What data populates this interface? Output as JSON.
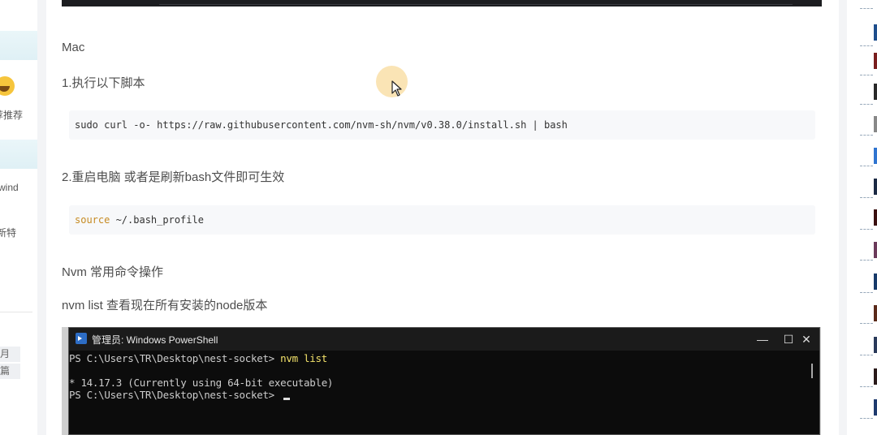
{
  "left_sidebar": {
    "texts": [
      "荐推荐",
      "wind",
      "新特"
    ],
    "chips": [
      "月",
      "篇"
    ]
  },
  "article": {
    "heading_mac": "Mac",
    "step1": "1.执行以下脚本",
    "code1": "sudo curl -o- https://raw.githubusercontent.com/nvm-sh/nvm/v0.38.0/install.sh | bash",
    "step2": "2.重启电脑 或者是刷新bash文件即可生效",
    "code2_keyword": "source",
    "code2_rest": " ~/.bash_profile",
    "heading_nvm": "Nvm 常用命令操作",
    "nvm_list_desc": "nvm list 查看现在所有安装的node版本"
  },
  "powershell": {
    "title": "管理员: Windows PowerShell",
    "prompt1": "PS C:\\Users\\TR\\Desktop\\nest-socket> ",
    "cmd1": "nvm list",
    "output1": "  * 14.17.3 (Currently using 64-bit executable)",
    "prompt2": "PS C:\\Users\\TR\\Desktop\\nest-socket> ",
    "minimize": "—",
    "maximize": "☐",
    "close": "✕"
  },
  "colors": {
    "accent_cursor_halo": "#f5cd78",
    "terminal_bg": "#0c0c0c",
    "terminal_cmd": "#f4e36b",
    "code_keyword": "#c68a22"
  },
  "icons": {
    "pointer": "mouse-pointer-icon",
    "powershell": "powershell-icon"
  }
}
